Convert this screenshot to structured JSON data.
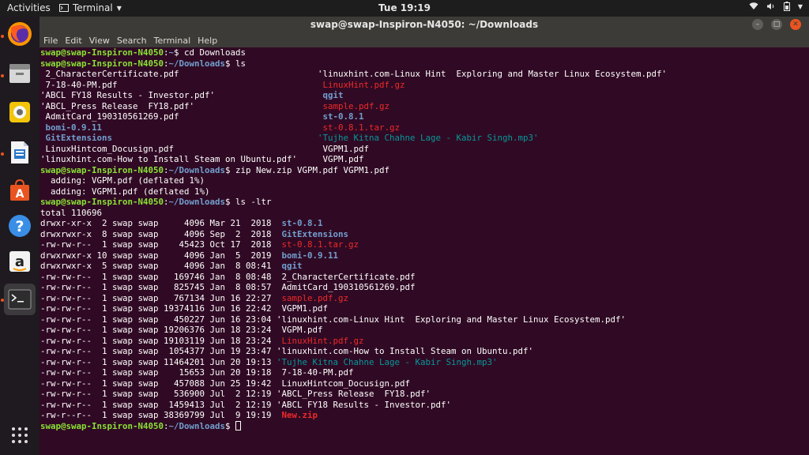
{
  "topbar": {
    "activities": "Activities",
    "app_name": "Terminal",
    "clock": "Tue 19:19"
  },
  "window": {
    "title": "swap@swap-Inspiron-N4050: ~/Downloads"
  },
  "menu": [
    "File",
    "Edit",
    "View",
    "Search",
    "Terminal",
    "Help"
  ],
  "colors": {
    "background": "#300a24",
    "prompt_user": "#8ae234",
    "prompt_path": "#729fcf",
    "archive_red": "#ef2929",
    "audio_cyan": "#06989a"
  },
  "dock": {
    "items": [
      {
        "icon": "firefox-icon"
      },
      {
        "icon": "files-icon"
      },
      {
        "icon": "rhythmbox-icon"
      },
      {
        "icon": "libreoffice-writer-icon"
      },
      {
        "icon": "software-center-icon"
      },
      {
        "icon": "help-icon"
      },
      {
        "icon": "amazon-icon"
      },
      {
        "icon": "terminal-icon"
      },
      {
        "icon": "show-applications-icon"
      }
    ]
  },
  "terminal": {
    "prompt_user": "swap@swap-Inspiron-N4050",
    "lines": [
      {
        "segs": [
          {
            "t": "swap@swap-Inspiron-N4050",
            "c": "prompt-user"
          },
          {
            "t": ":",
            "c": "c-white"
          },
          {
            "t": "~",
            "c": "prompt-path"
          },
          {
            "t": "$ cd Downloads",
            "c": "c-white"
          }
        ]
      },
      {
        "segs": [
          {
            "t": "swap@swap-Inspiron-N4050",
            "c": "prompt-user"
          },
          {
            "t": ":",
            "c": "c-white"
          },
          {
            "t": "~/Downloads",
            "c": "prompt-path"
          },
          {
            "t": "$ ls",
            "c": "c-white"
          }
        ]
      },
      {
        "segs": [
          {
            "t": " 2_CharacterCertificate.pdf",
            "c": "c-white"
          }
        ],
        "right": [
          {
            "t": "'linuxhint.com-Linux Hint  Exploring and Master Linux Ecosystem.pdf'",
            "c": "c-white"
          }
        ]
      },
      {
        "segs": [
          {
            "t": " 7-18-40-PM.pdf",
            "c": "c-white"
          }
        ],
        "right": [
          {
            "t": " LinuxHint.pdf.gz",
            "c": "c-red"
          }
        ]
      },
      {
        "segs": [
          {
            "t": "'ABCL FY18 Results - Investor.pdf'",
            "c": "c-white"
          }
        ],
        "right": [
          {
            "t": " qgit",
            "c": "c-blue"
          }
        ]
      },
      {
        "segs": [
          {
            "t": "'ABCL_Press Release  FY18.pdf'",
            "c": "c-white"
          }
        ],
        "right": [
          {
            "t": " sample.pdf.gz",
            "c": "c-red"
          }
        ]
      },
      {
        "segs": [
          {
            "t": " AdmitCard_190310561269.pdf",
            "c": "c-white"
          }
        ],
        "right": [
          {
            "t": " st-0.8.1",
            "c": "c-blue"
          }
        ]
      },
      {
        "segs": [
          {
            "t": " bomi-0.9.11",
            "c": "c-blue"
          }
        ],
        "right": [
          {
            "t": " st-0.8.1.tar.gz",
            "c": "c-red"
          }
        ]
      },
      {
        "segs": [
          {
            "t": " GitExtensions",
            "c": "c-blue"
          }
        ],
        "right": [
          {
            "t": "'Tujhe Kitna Chahne Lage - Kabir Singh.mp3'",
            "c": "c-cyan"
          }
        ]
      },
      {
        "segs": [
          {
            "t": " LinuxHintcom_Docusign.pdf",
            "c": "c-white"
          }
        ],
        "right": [
          {
            "t": " VGPM1.pdf",
            "c": "c-white"
          }
        ]
      },
      {
        "segs": [
          {
            "t": "'linuxhint.com-How to Install Steam on Ubuntu.pdf'",
            "c": "c-white"
          }
        ],
        "right": [
          {
            "t": " VGPM.pdf",
            "c": "c-white"
          }
        ]
      },
      {
        "segs": [
          {
            "t": "swap@swap-Inspiron-N4050",
            "c": "prompt-user"
          },
          {
            "t": ":",
            "c": "c-white"
          },
          {
            "t": "~/Downloads",
            "c": "prompt-path"
          },
          {
            "t": "$ zip New.zip VGPM.pdf VGPM1.pdf",
            "c": "c-white"
          }
        ]
      },
      {
        "segs": [
          {
            "t": "  adding: VGPM.pdf (deflated 1%)",
            "c": "c-white"
          }
        ]
      },
      {
        "segs": [
          {
            "t": "  adding: VGPM1.pdf (deflated 1%)",
            "c": "c-white"
          }
        ]
      },
      {
        "segs": [
          {
            "t": "swap@swap-Inspiron-N4050",
            "c": "prompt-user"
          },
          {
            "t": ":",
            "c": "c-white"
          },
          {
            "t": "~/Downloads",
            "c": "prompt-path"
          },
          {
            "t": "$ ls -ltr",
            "c": "c-white"
          }
        ]
      },
      {
        "segs": [
          {
            "t": "total 110696",
            "c": "c-white"
          }
        ]
      },
      {
        "segs": [
          {
            "t": "drwxr-xr-x  2 swap swap     4096 Mar 21  2018  ",
            "c": "c-white"
          },
          {
            "t": "st-0.8.1",
            "c": "c-blue"
          }
        ]
      },
      {
        "segs": [
          {
            "t": "drwxrwxr-x  8 swap swap     4096 Sep  2  2018  ",
            "c": "c-white"
          },
          {
            "t": "GitExtensions",
            "c": "c-blue"
          }
        ]
      },
      {
        "segs": [
          {
            "t": "-rw-rw-r--  1 swap swap    45423 Oct 17  2018  ",
            "c": "c-white"
          },
          {
            "t": "st-0.8.1.tar.gz",
            "c": "c-red"
          }
        ]
      },
      {
        "segs": [
          {
            "t": "drwxrwxr-x 10 swap swap     4096 Jan  5  2019  ",
            "c": "c-white"
          },
          {
            "t": "bomi-0.9.11",
            "c": "c-blue"
          }
        ]
      },
      {
        "segs": [
          {
            "t": "drwxrwxr-x  5 swap swap     4096 Jan  8 08:41  ",
            "c": "c-white"
          },
          {
            "t": "qgit",
            "c": "c-blue"
          }
        ]
      },
      {
        "segs": [
          {
            "t": "-rw-rw-r--  1 swap swap   169746 Jan  8 08:48  2_CharacterCertificate.pdf",
            "c": "c-white"
          }
        ]
      },
      {
        "segs": [
          {
            "t": "-rw-rw-r--  1 swap swap   825745 Jan  8 08:57  AdmitCard_190310561269.pdf",
            "c": "c-white"
          }
        ]
      },
      {
        "segs": [
          {
            "t": "-rw-rw-r--  1 swap swap   767134 Jun 16 22:27  ",
            "c": "c-white"
          },
          {
            "t": "sample.pdf.gz",
            "c": "c-red"
          }
        ]
      },
      {
        "segs": [
          {
            "t": "-rw-rw-r--  1 swap swap 19374116 Jun 16 22:42  VGPM1.pdf",
            "c": "c-white"
          }
        ]
      },
      {
        "segs": [
          {
            "t": "-rw-rw-r--  1 swap swap   450227 Jun 16 23:04 'linuxhint.com-Linux Hint  Exploring and Master Linux Ecosystem.pdf'",
            "c": "c-white"
          }
        ]
      },
      {
        "segs": [
          {
            "t": "-rw-rw-r--  1 swap swap 19206376 Jun 18 23:24  VGPM.pdf",
            "c": "c-white"
          }
        ]
      },
      {
        "segs": [
          {
            "t": "-rw-rw-r--  1 swap swap 19103119 Jun 18 23:24  ",
            "c": "c-white"
          },
          {
            "t": "LinuxHint.pdf.gz",
            "c": "c-red"
          }
        ]
      },
      {
        "segs": [
          {
            "t": "-rw-rw-r--  1 swap swap  1054377 Jun 19 23:47 'linuxhint.com-How to Install Steam on Ubuntu.pdf'",
            "c": "c-white"
          }
        ]
      },
      {
        "segs": [
          {
            "t": "-rw-rw-r--  1 swap swap 11464201 Jun 20 19:13 ",
            "c": "c-white"
          },
          {
            "t": "'Tujhe Kitna Chahne Lage - Kabir Singh.mp3'",
            "c": "c-cyan"
          }
        ]
      },
      {
        "segs": [
          {
            "t": "-rw-rw-r--  1 swap swap    15653 Jun 20 19:18  7-18-40-PM.pdf",
            "c": "c-white"
          }
        ]
      },
      {
        "segs": [
          {
            "t": "-rw-rw-r--  1 swap swap   457088 Jun 25 19:42  LinuxHintcom_Docusign.pdf",
            "c": "c-white"
          }
        ]
      },
      {
        "segs": [
          {
            "t": "-rw-rw-r--  1 swap swap   536900 Jul  2 12:19 'ABCL_Press Release  FY18.pdf'",
            "c": "c-white"
          }
        ]
      },
      {
        "segs": [
          {
            "t": "-rw-rw-r--  1 swap swap  1459413 Jul  2 12:19 'ABCL FY18 Results - Investor.pdf'",
            "c": "c-white"
          }
        ]
      },
      {
        "segs": [
          {
            "t": "-rw-r--r--  1 swap swap 38369799 Jul  9 19:19  ",
            "c": "c-white"
          },
          {
            "t": "New.zip",
            "c": "c-redb"
          }
        ]
      },
      {
        "segs": [
          {
            "t": "swap@swap-Inspiron-N4050",
            "c": "prompt-user"
          },
          {
            "t": ":",
            "c": "c-white"
          },
          {
            "t": "~/Downloads",
            "c": "prompt-path"
          },
          {
            "t": "$ ",
            "c": "c-white"
          }
        ],
        "cursor": true
      }
    ]
  }
}
